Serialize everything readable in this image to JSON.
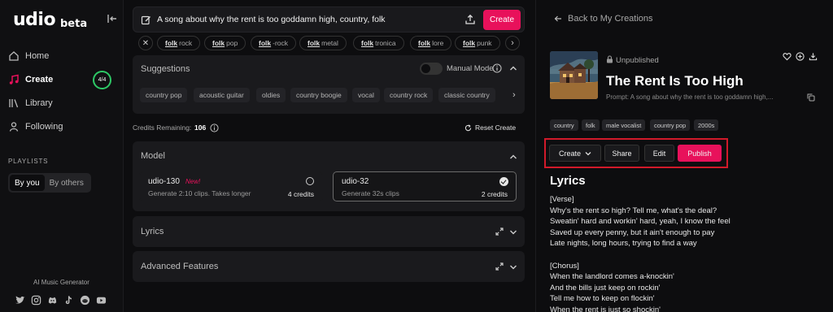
{
  "sidebar": {
    "logo": "udio",
    "logo_suffix": "beta",
    "nav": [
      {
        "label": "Home",
        "icon": "home-icon"
      },
      {
        "label": "Create",
        "icon": "music-note-icon",
        "badge": "4/4"
      },
      {
        "label": "Library",
        "icon": "library-icon"
      },
      {
        "label": "Following",
        "icon": "user-icon"
      }
    ],
    "playlists_label": "PLAYLISTS",
    "playlist_tabs": [
      "By you",
      "By others"
    ],
    "footer_label": "AI Music Generator",
    "socials": [
      "twitter-icon",
      "instagram-icon",
      "discord-icon",
      "tiktok-icon",
      "reddit-icon",
      "youtube-icon"
    ]
  },
  "prompt": {
    "text": "A song about why the rent is too goddamn high, country, folk",
    "create_label": "Create"
  },
  "tag_chips": [
    {
      "bold": "folk",
      "rest": "rock"
    },
    {
      "bold": "folk",
      "rest": "pop"
    },
    {
      "bold": "folk",
      "rest": "-rock"
    },
    {
      "bold": "folk",
      "rest": "metal"
    },
    {
      "bold": "folk",
      "rest": "tronica"
    },
    {
      "bold": "folk",
      "rest": "lore"
    },
    {
      "bold": "folk",
      "rest": "punk"
    }
  ],
  "suggestions": {
    "title": "Suggestions",
    "manual_mode_label": "Manual Mode",
    "chips": [
      "country pop",
      "acoustic guitar",
      "oldies",
      "country boogie",
      "vocal",
      "country rock",
      "classic country"
    ]
  },
  "credits": {
    "label": "Credits Remaining:",
    "value": "106",
    "reset_label": "Reset Create"
  },
  "model": {
    "title": "Model",
    "options": [
      {
        "name": "udio-130",
        "tag": "New!",
        "desc": "Generate 2:10 clips. Takes longer",
        "credits": "4 credits",
        "selected": false
      },
      {
        "name": "udio-32",
        "tag": "",
        "desc": "Generate 32s clips",
        "credits": "2 credits",
        "selected": true
      }
    ]
  },
  "collapsed_panels": {
    "lyrics": "Lyrics",
    "advanced": "Advanced Features"
  },
  "detail": {
    "back_label": "Back to My Creations",
    "status": "Unpublished",
    "title": "The Rent Is Too High",
    "prompt_line": "Prompt: A song about why the rent is too goddamn high,...",
    "genre_tags": [
      "country",
      "folk",
      "male vocalist",
      "country pop",
      "2000s"
    ],
    "actions": {
      "create": "Create",
      "share": "Share",
      "edit": "Edit",
      "publish": "Publish"
    },
    "lyrics_heading": "Lyrics",
    "lyrics": [
      "[Verse]",
      "Why's the rent so high? Tell me, what's the deal?",
      "Sweatin' hard and workin' hard, yeah, I know the feel",
      "Saved up every penny, but it ain't enough to pay",
      "Late nights, long hours, trying to find a way",
      "",
      "[Chorus]",
      "When the landlord comes a-knockin'",
      "And the bills just keep on rockin'",
      "Tell me how to keep on flockin'",
      "When the rent is just so shockin'"
    ]
  },
  "colors": {
    "accent": "#e8115b",
    "highlight_box": "#d11a2a",
    "credit_ring": "#2ec866",
    "background": "#0d0d0f",
    "panel": "#1a1a1d"
  }
}
